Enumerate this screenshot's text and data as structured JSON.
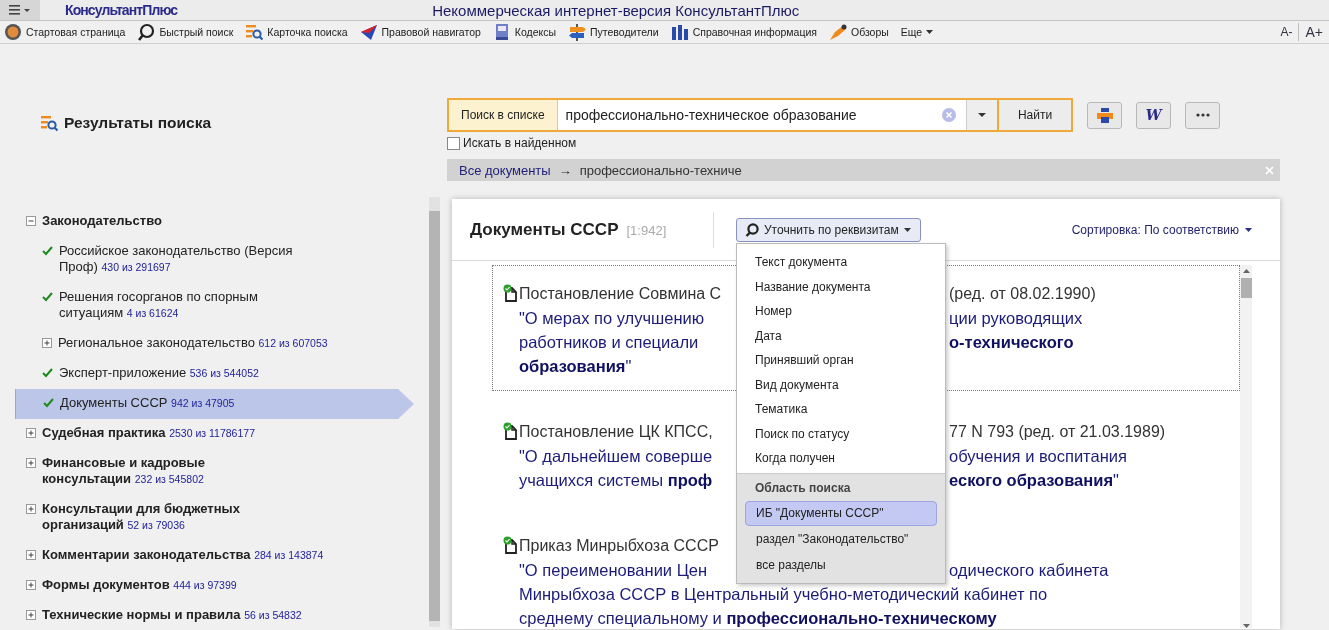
{
  "app": {
    "logo": "КонсультантПлюс",
    "title": "Некоммерческая интернет-версия КонсультантПлюс"
  },
  "toolbar": [
    {
      "kind": "home",
      "label": "Стартовая страница"
    },
    {
      "kind": "search",
      "label": "Быстрый поиск"
    },
    {
      "kind": "card",
      "label": "Карточка поиска"
    },
    {
      "kind": "navigator",
      "label": "Правовой навигатор"
    },
    {
      "kind": "codes",
      "label": "Кодексы"
    },
    {
      "kind": "guides",
      "label": "Путеводители"
    },
    {
      "kind": "reference",
      "label": "Справочная информация"
    },
    {
      "kind": "reviews",
      "label": "Обзоры"
    },
    {
      "kind": "more",
      "label": "Еще"
    }
  ],
  "font_buttons": [
    "A-",
    "A+"
  ],
  "results_heading": "Результаты поиска",
  "search": {
    "label": "Поиск в списке",
    "value": "профессионально-техническое образование",
    "button": "Найти",
    "word_button": "W"
  },
  "search_in_found": {
    "label": "Искать в найденном",
    "checked": false
  },
  "breadcrumb": {
    "link": "Все документы",
    "arrow": "→",
    "current": "профессионально-техниче"
  },
  "tree": [
    {
      "kind": "folder",
      "label": "Законодательство",
      "expanded": true,
      "selected": false,
      "children": [
        {
          "kind": "base",
          "label": "Российское законодательство (Версия\nПроф)",
          "count": "430 из 291697",
          "checked": true,
          "selected": false
        },
        {
          "kind": "base",
          "label": "Решения госорганов по спорным\nситуациям",
          "count": "4 из 61624",
          "checked": true,
          "selected": false
        },
        {
          "kind": "folder",
          "label": "Региональное законодательство",
          "count": "612 из 607053",
          "expanded": false,
          "selected": false
        },
        {
          "kind": "base",
          "label": "Эксперт-приложение",
          "count": "536 из 544052",
          "checked": true,
          "selected": false
        },
        {
          "kind": "base",
          "label": "Документы СССР",
          "count": "942 из 47905",
          "checked": true,
          "selected": true
        }
      ]
    },
    {
      "kind": "folder",
      "label": "Судебная практика",
      "count": "2530 из 11786177",
      "expanded": false,
      "selected": false
    },
    {
      "kind": "folder",
      "label": "Финансовые и кадровые\nконсультации",
      "count": "232 из 545802",
      "expanded": false,
      "selected": false
    },
    {
      "kind": "folder",
      "label": "Консультации для бюджетных\nорганизаций",
      "count": "52 из 79036",
      "expanded": false,
      "selected": false
    },
    {
      "kind": "folder",
      "label": "Комментарии законодательства",
      "count": "284 из 143874",
      "expanded": false,
      "selected": false
    },
    {
      "kind": "folder",
      "label": "Формы документов",
      "count": "444 из 97399",
      "expanded": false,
      "selected": false
    },
    {
      "kind": "folder",
      "label": "Технические нормы и правила",
      "count": "56 из 54832",
      "expanded": false,
      "selected": false
    }
  ],
  "panel": {
    "title": "Документы СССР",
    "range": "[1:942]",
    "refine_button": "Уточнить по реквизитам",
    "sort": "Сортировка: По соответствию"
  },
  "documents": [
    {
      "selected": true,
      "lines": [
        {
          "kind": "citation",
          "left": "Постановление Совмина С",
          "right": "(ред. от 08.02.1990)"
        },
        {
          "kind": "title",
          "left": "\"О мерах по улучшению",
          "right": "ции руководящих"
        },
        {
          "kind": "title",
          "left": "работников и специали",
          "right": "**о-технического**"
        },
        {
          "kind": "title",
          "text": "**образования**\""
        }
      ]
    },
    {
      "selected": false,
      "lines": [
        {
          "kind": "citation",
          "left": "Постановление ЦК КПСС,",
          "right": "77 N 793 (ред. от 21.03.1989)"
        },
        {
          "kind": "title",
          "left": "\"О дальнейшем соверше",
          "right": "обучения и воспитания"
        },
        {
          "kind": "title",
          "left": "учащихся системы **проф**",
          "right": "**еского образования**\""
        }
      ]
    },
    {
      "selected": false,
      "lines": [
        {
          "kind": "citation",
          "left": "Приказ Минрыбхоза СССР"
        },
        {
          "kind": "title",
          "left": "\"О переименовании Цен",
          "right": "одического кабинета"
        },
        {
          "kind": "title",
          "text": "Минрыбхоза СССР в Центральный учебно-методический кабинет по"
        },
        {
          "kind": "title",
          "text": "среднему специальному и **профессионально-техническому**"
        }
      ]
    }
  ],
  "refine_menu": {
    "fields": [
      "Текст документа",
      "Название документа",
      "Номер",
      "Дата",
      "Принявший орган",
      "Вид документа",
      "Тематика",
      "Поиск по статусу",
      "Когда получен"
    ],
    "section": "Область поиска",
    "scopes": [
      {
        "label": "ИБ \"Документы СССР\"",
        "selected": true
      },
      {
        "label": "раздел \"Законодательство\"",
        "selected": false
      },
      {
        "label": "все разделы",
        "selected": false
      }
    ]
  }
}
